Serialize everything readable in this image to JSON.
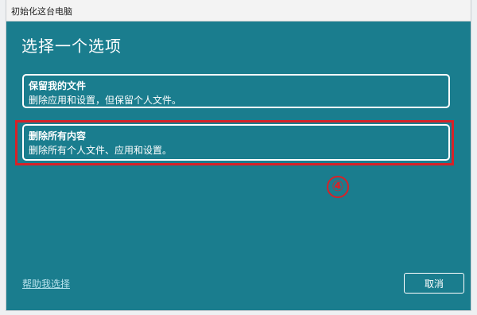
{
  "window": {
    "title": "初始化这台电脑"
  },
  "heading": "选择一个选项",
  "options": [
    {
      "title": "保留我的文件",
      "description": "删除应用和设置，但保留个人文件。"
    },
    {
      "title": "删除所有内容",
      "description": "删除所有个人文件、应用和设置。"
    }
  ],
  "annotation": {
    "step": "④",
    "color": "#d62228"
  },
  "footer": {
    "help_link": "帮助我选择",
    "cancel_label": "取消"
  },
  "colors": {
    "window_bg": "#1a7d8e",
    "text": "#ffffff",
    "link": "#b8e3ee"
  }
}
